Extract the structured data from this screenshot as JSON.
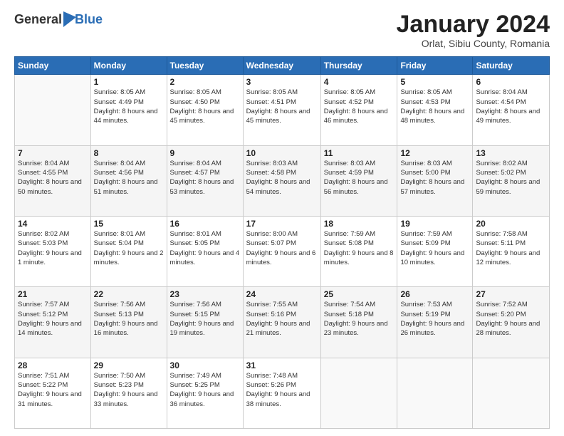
{
  "header": {
    "logo_general": "General",
    "logo_blue": "Blue",
    "month_title": "January 2024",
    "location": "Orlat, Sibiu County, Romania"
  },
  "days_of_week": [
    "Sunday",
    "Monday",
    "Tuesday",
    "Wednesday",
    "Thursday",
    "Friday",
    "Saturday"
  ],
  "weeks": [
    [
      {
        "day": "",
        "sunrise": "",
        "sunset": "",
        "daylight": ""
      },
      {
        "day": "1",
        "sunrise": "Sunrise: 8:05 AM",
        "sunset": "Sunset: 4:49 PM",
        "daylight": "Daylight: 8 hours and 44 minutes."
      },
      {
        "day": "2",
        "sunrise": "Sunrise: 8:05 AM",
        "sunset": "Sunset: 4:50 PM",
        "daylight": "Daylight: 8 hours and 45 minutes."
      },
      {
        "day": "3",
        "sunrise": "Sunrise: 8:05 AM",
        "sunset": "Sunset: 4:51 PM",
        "daylight": "Daylight: 8 hours and 45 minutes."
      },
      {
        "day": "4",
        "sunrise": "Sunrise: 8:05 AM",
        "sunset": "Sunset: 4:52 PM",
        "daylight": "Daylight: 8 hours and 46 minutes."
      },
      {
        "day": "5",
        "sunrise": "Sunrise: 8:05 AM",
        "sunset": "Sunset: 4:53 PM",
        "daylight": "Daylight: 8 hours and 48 minutes."
      },
      {
        "day": "6",
        "sunrise": "Sunrise: 8:04 AM",
        "sunset": "Sunset: 4:54 PM",
        "daylight": "Daylight: 8 hours and 49 minutes."
      }
    ],
    [
      {
        "day": "7",
        "sunrise": "Sunrise: 8:04 AM",
        "sunset": "Sunset: 4:55 PM",
        "daylight": "Daylight: 8 hours and 50 minutes."
      },
      {
        "day": "8",
        "sunrise": "Sunrise: 8:04 AM",
        "sunset": "Sunset: 4:56 PM",
        "daylight": "Daylight: 8 hours and 51 minutes."
      },
      {
        "day": "9",
        "sunrise": "Sunrise: 8:04 AM",
        "sunset": "Sunset: 4:57 PM",
        "daylight": "Daylight: 8 hours and 53 minutes."
      },
      {
        "day": "10",
        "sunrise": "Sunrise: 8:03 AM",
        "sunset": "Sunset: 4:58 PM",
        "daylight": "Daylight: 8 hours and 54 minutes."
      },
      {
        "day": "11",
        "sunrise": "Sunrise: 8:03 AM",
        "sunset": "Sunset: 4:59 PM",
        "daylight": "Daylight: 8 hours and 56 minutes."
      },
      {
        "day": "12",
        "sunrise": "Sunrise: 8:03 AM",
        "sunset": "Sunset: 5:00 PM",
        "daylight": "Daylight: 8 hours and 57 minutes."
      },
      {
        "day": "13",
        "sunrise": "Sunrise: 8:02 AM",
        "sunset": "Sunset: 5:02 PM",
        "daylight": "Daylight: 8 hours and 59 minutes."
      }
    ],
    [
      {
        "day": "14",
        "sunrise": "Sunrise: 8:02 AM",
        "sunset": "Sunset: 5:03 PM",
        "daylight": "Daylight: 9 hours and 1 minute."
      },
      {
        "day": "15",
        "sunrise": "Sunrise: 8:01 AM",
        "sunset": "Sunset: 5:04 PM",
        "daylight": "Daylight: 9 hours and 2 minutes."
      },
      {
        "day": "16",
        "sunrise": "Sunrise: 8:01 AM",
        "sunset": "Sunset: 5:05 PM",
        "daylight": "Daylight: 9 hours and 4 minutes."
      },
      {
        "day": "17",
        "sunrise": "Sunrise: 8:00 AM",
        "sunset": "Sunset: 5:07 PM",
        "daylight": "Daylight: 9 hours and 6 minutes."
      },
      {
        "day": "18",
        "sunrise": "Sunrise: 7:59 AM",
        "sunset": "Sunset: 5:08 PM",
        "daylight": "Daylight: 9 hours and 8 minutes."
      },
      {
        "day": "19",
        "sunrise": "Sunrise: 7:59 AM",
        "sunset": "Sunset: 5:09 PM",
        "daylight": "Daylight: 9 hours and 10 minutes."
      },
      {
        "day": "20",
        "sunrise": "Sunrise: 7:58 AM",
        "sunset": "Sunset: 5:11 PM",
        "daylight": "Daylight: 9 hours and 12 minutes."
      }
    ],
    [
      {
        "day": "21",
        "sunrise": "Sunrise: 7:57 AM",
        "sunset": "Sunset: 5:12 PM",
        "daylight": "Daylight: 9 hours and 14 minutes."
      },
      {
        "day": "22",
        "sunrise": "Sunrise: 7:56 AM",
        "sunset": "Sunset: 5:13 PM",
        "daylight": "Daylight: 9 hours and 16 minutes."
      },
      {
        "day": "23",
        "sunrise": "Sunrise: 7:56 AM",
        "sunset": "Sunset: 5:15 PM",
        "daylight": "Daylight: 9 hours and 19 minutes."
      },
      {
        "day": "24",
        "sunrise": "Sunrise: 7:55 AM",
        "sunset": "Sunset: 5:16 PM",
        "daylight": "Daylight: 9 hours and 21 minutes."
      },
      {
        "day": "25",
        "sunrise": "Sunrise: 7:54 AM",
        "sunset": "Sunset: 5:18 PM",
        "daylight": "Daylight: 9 hours and 23 minutes."
      },
      {
        "day": "26",
        "sunrise": "Sunrise: 7:53 AM",
        "sunset": "Sunset: 5:19 PM",
        "daylight": "Daylight: 9 hours and 26 minutes."
      },
      {
        "day": "27",
        "sunrise": "Sunrise: 7:52 AM",
        "sunset": "Sunset: 5:20 PM",
        "daylight": "Daylight: 9 hours and 28 minutes."
      }
    ],
    [
      {
        "day": "28",
        "sunrise": "Sunrise: 7:51 AM",
        "sunset": "Sunset: 5:22 PM",
        "daylight": "Daylight: 9 hours and 31 minutes."
      },
      {
        "day": "29",
        "sunrise": "Sunrise: 7:50 AM",
        "sunset": "Sunset: 5:23 PM",
        "daylight": "Daylight: 9 hours and 33 minutes."
      },
      {
        "day": "30",
        "sunrise": "Sunrise: 7:49 AM",
        "sunset": "Sunset: 5:25 PM",
        "daylight": "Daylight: 9 hours and 36 minutes."
      },
      {
        "day": "31",
        "sunrise": "Sunrise: 7:48 AM",
        "sunset": "Sunset: 5:26 PM",
        "daylight": "Daylight: 9 hours and 38 minutes."
      },
      {
        "day": "",
        "sunrise": "",
        "sunset": "",
        "daylight": ""
      },
      {
        "day": "",
        "sunrise": "",
        "sunset": "",
        "daylight": ""
      },
      {
        "day": "",
        "sunrise": "",
        "sunset": "",
        "daylight": ""
      }
    ]
  ]
}
